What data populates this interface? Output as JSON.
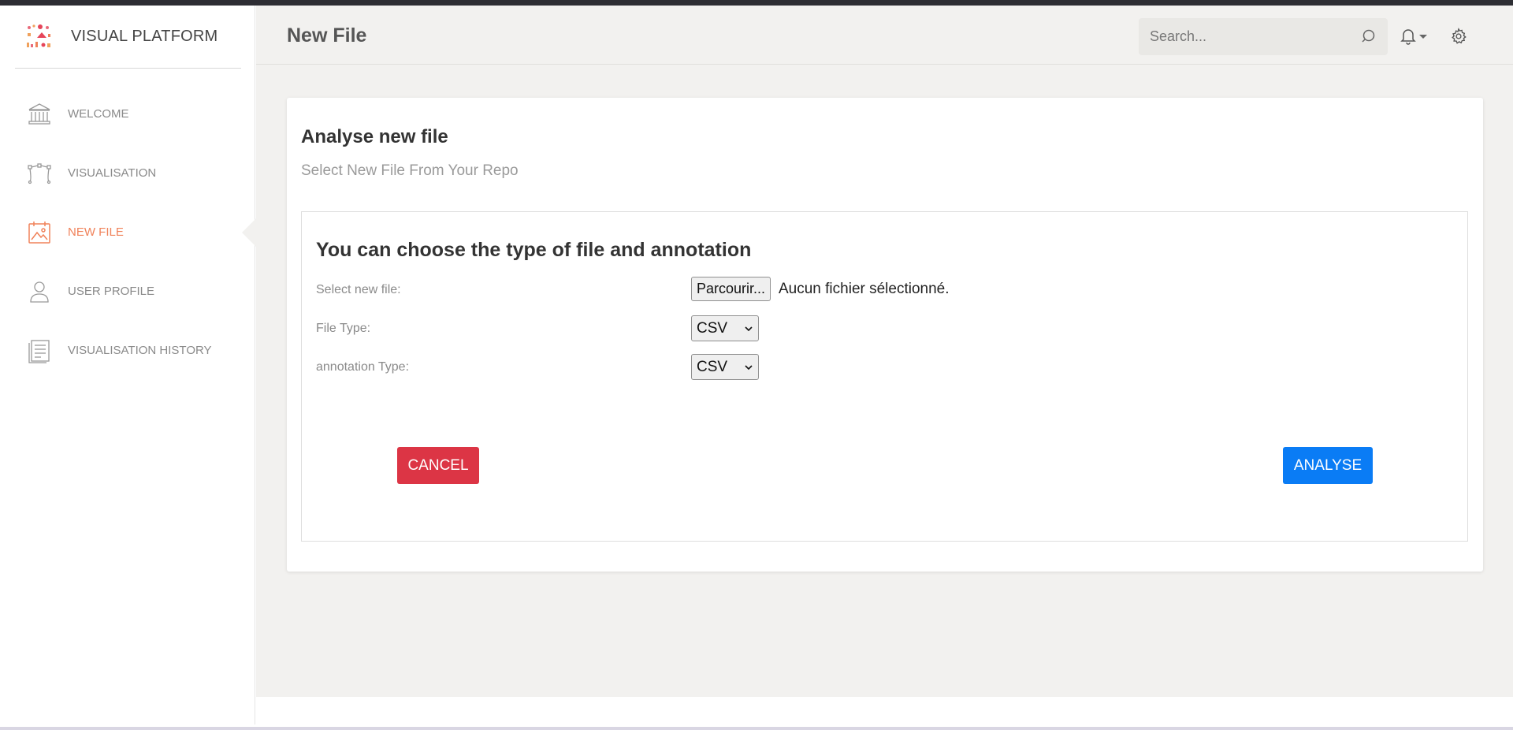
{
  "brand": {
    "name": "VISUAL PLATFORM"
  },
  "sidebar": {
    "items": [
      {
        "label": "WELCOME",
        "icon": "bank-icon",
        "active": false
      },
      {
        "label": "VISUALISATION",
        "icon": "bezier-icon",
        "active": false
      },
      {
        "label": "NEW FILE",
        "icon": "calendar-image-icon",
        "active": true
      },
      {
        "label": "USER PROFILE",
        "icon": "user-icon",
        "active": false
      },
      {
        "label": "VISUALISATION HISTORY",
        "icon": "document-icon",
        "active": false
      }
    ]
  },
  "header": {
    "title": "New File",
    "search_placeholder": "Search...",
    "icons": [
      "search-icon",
      "bell-icon",
      "gear-icon"
    ]
  },
  "card": {
    "title": "Analyse new file",
    "subtitle": "Select New File From Your Repo",
    "form": {
      "heading": "You can choose the type of file and annotation",
      "file_label": "Select new file:",
      "file_button": "Parcourir...",
      "file_status": "Aucun fichier sélectionné.",
      "file_type_label": "File Type:",
      "file_type_value": "CSV",
      "annotation_label": "annotation Type:",
      "annotation_value": "CSV"
    },
    "cancel_label": "CANCEL",
    "analyse_label": "ANALYSE"
  },
  "colors": {
    "accent": "#f0825a",
    "cancel": "#dc3545",
    "analyse": "#0a7cf5",
    "background": "#f2f1ef"
  }
}
